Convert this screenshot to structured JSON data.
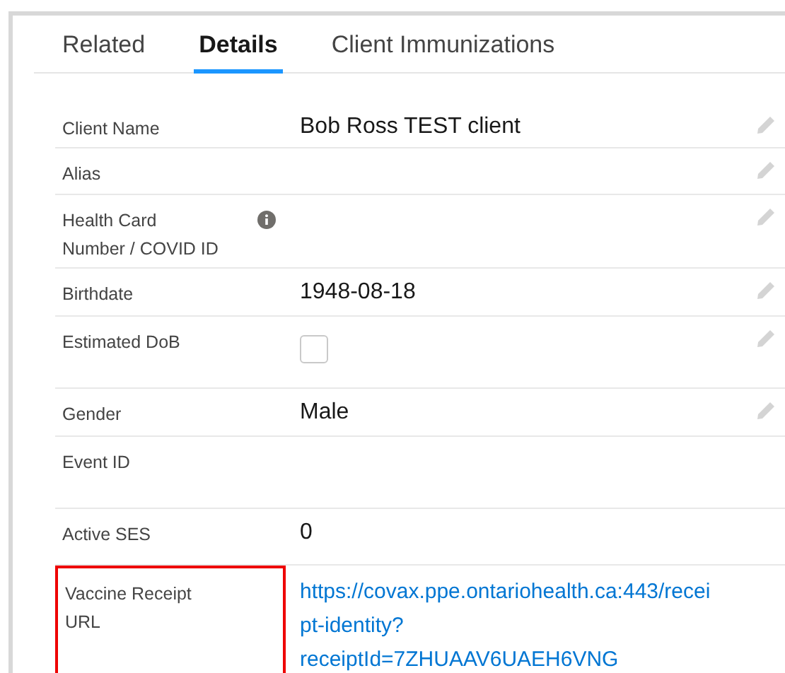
{
  "tabs": [
    {
      "label": "Related",
      "selected": false
    },
    {
      "label": "Details",
      "selected": true
    },
    {
      "label": "Client Immunizations",
      "selected": false
    }
  ],
  "fields": [
    {
      "kind": "text",
      "label": "Client Name",
      "value": "Bob Ross TEST client",
      "editable": true
    },
    {
      "kind": "text",
      "label": "Alias",
      "editable": true
    },
    {
      "kind": "text",
      "label": "Health Card Number / COVID ID",
      "info": true,
      "editable": true
    },
    {
      "kind": "text",
      "label": "Birthdate",
      "value": "1948-08-18",
      "editable": true
    },
    {
      "kind": "checkbox",
      "label": "Estimated DoB",
      "checked": false,
      "editable": true
    },
    {
      "kind": "text",
      "label": "Gender",
      "value": "Male",
      "editable": true
    },
    {
      "kind": "text",
      "label": "Event ID",
      "editable": false
    },
    {
      "kind": "text",
      "label": "Active SES",
      "value": "0",
      "editable": false
    },
    {
      "kind": "link",
      "label": "Vaccine Receipt URL",
      "value": "https://covax.ppe.ontariohealth.ca:443/receipt-identity?receiptId=7ZHUAAV6UAEH6VNG",
      "editable": false,
      "highlighted": true
    }
  ]
}
